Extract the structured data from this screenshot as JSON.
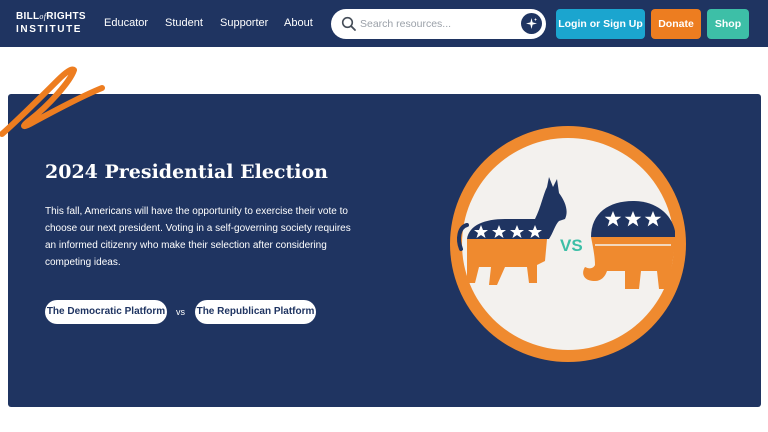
{
  "header": {
    "logo": {
      "line1_a": "BILL",
      "line1_of": "of",
      "line1_b": "RIGHTS",
      "line2": "INSTITUTE"
    },
    "nav": [
      {
        "label": "Educator"
      },
      {
        "label": "Student"
      },
      {
        "label": "Supporter"
      },
      {
        "label": "About"
      }
    ],
    "search": {
      "placeholder": "Search resources...",
      "icon": "search-icon",
      "ai_icon": "sparkle-icon"
    },
    "buttons": {
      "login": "Login or Sign Up",
      "donate": "Donate",
      "shop": "Shop"
    }
  },
  "hero": {
    "title": "2024 Presidential Election",
    "description": "This fall, Americans will have the opportunity to exercise their vote to choose our next president. Voting in a self-governing society requires an informed citizenry who make their selection after considering competing ideas.",
    "democratic_button": "The Democratic Platform",
    "vs": "vs",
    "republican_button": "The Republican Platform",
    "emblem_vs": "VS"
  },
  "colors": {
    "navy": "#1f3461",
    "login": "#1ba5cf",
    "donate": "#ed7d20",
    "shop": "#3dbfa7",
    "emblem_ring": "#ef8a2f",
    "emblem_bg": "#f3f1ee",
    "vs_teal": "#3dbfa7"
  }
}
